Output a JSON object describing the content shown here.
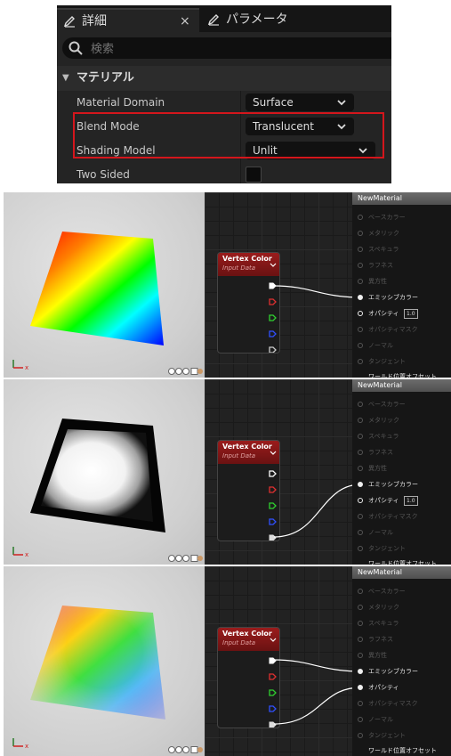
{
  "details": {
    "tabs": [
      {
        "label": "詳細",
        "icon": "pencil-icon",
        "close": "×"
      },
      {
        "label": "パラメータ",
        "icon": "pencil-icon"
      }
    ],
    "search": {
      "placeholder": "検索"
    },
    "section": {
      "label": "マテリアル"
    },
    "properties": [
      {
        "label": "Material Domain",
        "value": "Surface"
      },
      {
        "label": "Blend Mode",
        "value": "Translucent"
      },
      {
        "label": "Shading Model",
        "value": "Unlit"
      },
      {
        "label": "Two Sided",
        "value": ""
      }
    ],
    "highlight_color": "#d4161c"
  },
  "vertex_node": {
    "title": "Vertex Color",
    "subtitle": "Input Data",
    "pin_colors": [
      "#ffffff",
      "#e03030",
      "#30d030",
      "#3050ff",
      "#cccccc"
    ]
  },
  "material_node": {
    "title": "NewMaterial",
    "inputs": [
      "ベースカラー",
      "メタリック",
      "スペキュラ",
      "ラフネス",
      "異方性",
      "エミッシブカラー",
      "オパシティ",
      "オパシティマスク",
      "ノーマル",
      "タンジェント"
    ],
    "last_input": "ワールド位置オフセット",
    "opacity_value": "1.0"
  },
  "panels": [
    {
      "emissive_from": "white",
      "opacity_from": "",
      "shape": "rainbow-quad",
      "show_opacity_value": true
    },
    {
      "emissive_from": "alpha",
      "opacity_from": "",
      "shape": "white-cube",
      "show_opacity_value": true
    },
    {
      "emissive_from": "white",
      "opacity_from": "alpha",
      "shape": "rainbow-cube",
      "show_opacity_value": false
    }
  ]
}
